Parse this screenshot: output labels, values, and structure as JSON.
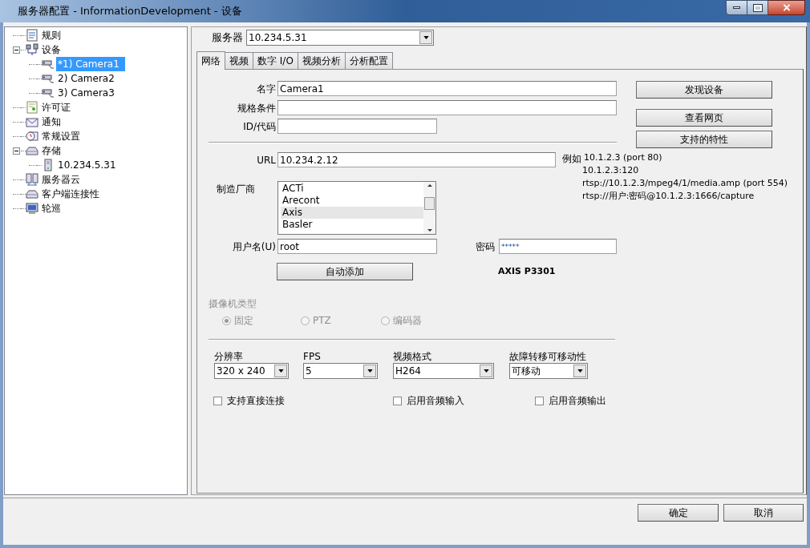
{
  "window": {
    "title": "服务器配置 - InformationDevelopment - 设备"
  },
  "tree": [
    {
      "label": "规则",
      "selected": false
    },
    {
      "label": "设备",
      "selected": false,
      "expanded": true,
      "children": [
        {
          "label": "*1) Camera1",
          "selected": true
        },
        {
          "label": "2) Camera2",
          "selected": false
        },
        {
          "label": "3) Camera3",
          "selected": false
        }
      ]
    },
    {
      "label": "许可证",
      "selected": false
    },
    {
      "label": "通知",
      "selected": false
    },
    {
      "label": "常规设置",
      "selected": false
    },
    {
      "label": "存储",
      "selected": false,
      "expanded": true,
      "children": [
        {
          "label": "10.234.5.31",
          "selected": false
        }
      ]
    },
    {
      "label": "服务器云",
      "selected": false
    },
    {
      "label": "客户端连接性",
      "selected": false
    },
    {
      "label": "轮巡",
      "selected": false
    }
  ],
  "server": {
    "label": "服务器",
    "value": "10.234.5.31"
  },
  "tabs": [
    {
      "label": "网络",
      "selected": true
    },
    {
      "label": "视频",
      "selected": false
    },
    {
      "label": "数字 I/O",
      "selected": false
    },
    {
      "label": "视频分析",
      "selected": false
    },
    {
      "label": "分析配置",
      "selected": false
    }
  ],
  "form": {
    "name": {
      "label": "名字",
      "value": "Camera1"
    },
    "spec": {
      "label": "规格条件"
    },
    "id": {
      "label": "ID/代码"
    },
    "url": {
      "label": "URL",
      "value": "10.234.2.12"
    },
    "example": {
      "label": "例如",
      "lines": [
        "10.1.2.3 (port 80)",
        "10.1.2.3:120",
        "rtsp://10.1.2.3/mpeg4/1/media.amp (port 554)",
        "rtsp://用户:密码@10.1.2.3:1666/capture"
      ]
    },
    "manufacturer": {
      "label": "制造厂商",
      "options": [
        {
          "label": "ACTi",
          "selected": false
        },
        {
          "label": "Arecont",
          "selected": false
        },
        {
          "label": "Axis",
          "selected": true
        },
        {
          "label": "Basler",
          "selected": false
        }
      ]
    },
    "username": {
      "label": "用户名(U)",
      "value": "root"
    },
    "password": {
      "label": "密码",
      "value": "*****"
    },
    "auto_add": "自动添加",
    "model": "AXIS P3301",
    "camera_type": {
      "label": "摄像机类型",
      "disabled": true,
      "options": [
        {
          "label": "固定",
          "selected": true
        },
        {
          "label": "PTZ",
          "selected": false
        },
        {
          "label": "编码器",
          "selected": false
        }
      ]
    },
    "selects": [
      {
        "label": "分辨率",
        "value": "320 x 240"
      },
      {
        "label": "FPS",
        "value": "5"
      },
      {
        "label": "视频格式",
        "value": "H264"
      },
      {
        "label": "故障转移可移动性",
        "value": "可移动"
      }
    ],
    "checkboxes": [
      {
        "label": "支持直接连接",
        "checked": false
      },
      {
        "label": "启用音频输入",
        "checked": false
      },
      {
        "label": "启用音频输出",
        "checked": false
      }
    ]
  },
  "side_buttons": [
    "发现设备",
    "查看网页",
    "支持的特性"
  ],
  "footer_buttons": [
    "确定",
    "取消"
  ]
}
